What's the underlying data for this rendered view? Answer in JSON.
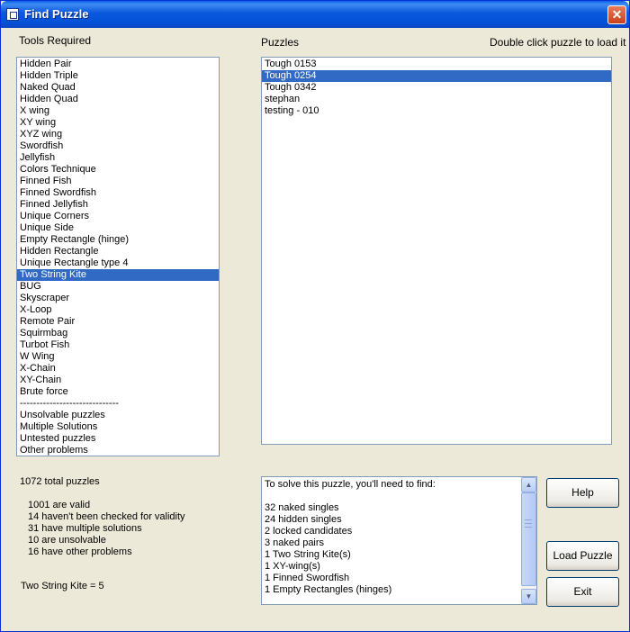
{
  "window": {
    "title": "Find Puzzle",
    "close_glyph": "✕"
  },
  "tools": {
    "label": "Tools Required",
    "items": [
      "Hidden Pair",
      "Hidden Triple",
      "Naked Quad",
      "Hidden Quad",
      "X wing",
      "XY wing",
      "XYZ wing",
      "Swordfish",
      "Jellyfish",
      "Colors Technique",
      "Finned Fish",
      "Finned Swordfish",
      "Finned Jellyfish",
      "Unique Corners",
      "Unique Side",
      "Empty Rectangle (hinge)",
      "Hidden Rectangle",
      "Unique Rectangle type 4",
      "Two String Kite",
      "BUG",
      "Skyscraper",
      "X-Loop",
      "Remote Pair",
      "Squirmbag",
      "Turbot Fish",
      "W Wing",
      "X-Chain",
      "XY-Chain",
      "Brute force",
      "------------------------------",
      "Unsolvable puzzles",
      "Multiple Solutions",
      "Untested puzzles",
      "Other problems"
    ],
    "selected_index": 18
  },
  "puzzles": {
    "label": "Puzzles",
    "hint": "Double click puzzle to load it",
    "items": [
      "Tough 0153",
      "Tough 0254",
      "Tough 0342",
      "stephan",
      "testing - 010"
    ],
    "selected_index": 1
  },
  "stats": {
    "total": "1072 total puzzles",
    "lines": [
      "1001 are valid",
      "14 haven't been checked for validity",
      "31 have multiple solutions",
      "10 are unsolvable",
      "16 have other problems"
    ],
    "selected_count": "Two String Kite = 5"
  },
  "requirements": {
    "lines": [
      "To solve this puzzle, you'll need to find:",
      "",
      "32 naked singles",
      "24 hidden singles",
      "2 locked candidates",
      "3 naked pairs",
      "1 Two String Kite(s)",
      "1 XY-wing(s)",
      "1 Finned Swordfish",
      "1 Empty Rectangles (hinges)"
    ]
  },
  "buttons": {
    "help": "Help",
    "load": "Load Puzzle",
    "exit": "Exit"
  },
  "icons": {
    "scroll_up": "▲",
    "scroll_down": "▼"
  },
  "colors": {
    "selection": "#316ac5",
    "titlebar": "#0a58dc",
    "face": "#ece9d8"
  }
}
